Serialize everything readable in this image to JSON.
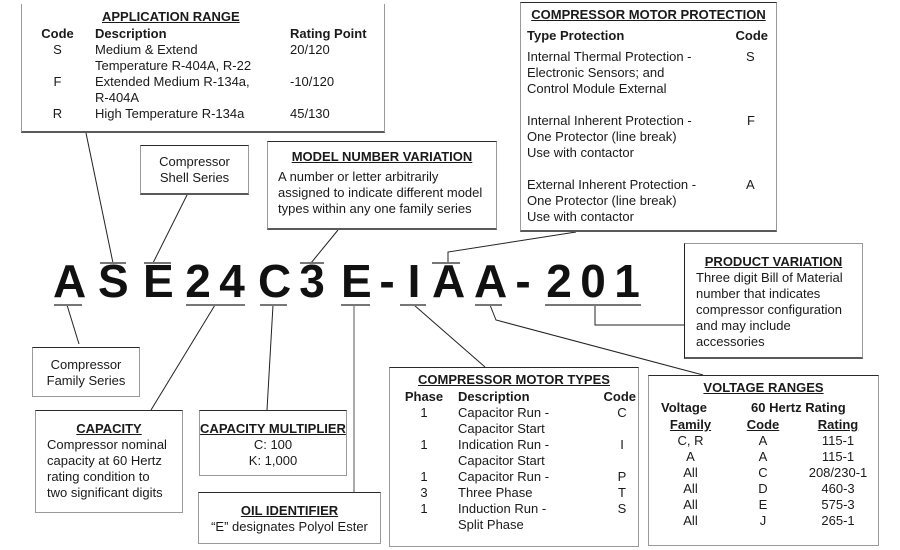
{
  "model_number": {
    "characters": [
      "A",
      "S",
      "E",
      "2",
      "4",
      "C",
      "3",
      "E",
      "-",
      "I",
      "A",
      "A",
      "-",
      "2",
      "0",
      "1"
    ]
  },
  "application_range": {
    "title": "APPLICATION RANGE",
    "headers": [
      "Code",
      "Description",
      "Rating Point"
    ],
    "rows": [
      {
        "code": "S",
        "description_lines": [
          "Medium & Extend",
          "Temperature R-404A, R-22"
        ],
        "rating": "20/120"
      },
      {
        "code": "F",
        "description_lines": [
          "Extended Medium R-134a,",
          "R-404A"
        ],
        "rating": "-10/120"
      },
      {
        "code": "R",
        "description_lines": [
          "High Temperature R-134a"
        ],
        "rating": "45/130"
      }
    ]
  },
  "shell_series": {
    "lines": [
      "Compressor",
      "Shell Series"
    ]
  },
  "model_number_variation": {
    "title": "MODEL NUMBER VARIATION",
    "lines": [
      "A number or letter arbitrarily",
      "assigned to indicate different model",
      "types within any one family series"
    ]
  },
  "motor_protection": {
    "title": "COMPRESSOR MOTOR PROTECTION",
    "headers": [
      "Type Protection",
      "Code"
    ],
    "rows": [
      {
        "lines": [
          "Internal Thermal Protection -",
          "Electronic Sensors; and",
          "Control Module External"
        ],
        "code": "S"
      },
      {
        "lines": [
          "Internal Inherent Protection -",
          "One Protector (line break)",
          "Use with contactor"
        ],
        "code": "F"
      },
      {
        "lines": [
          "External Inherent Protection -",
          "One Protector (line break)",
          "Use with contactor"
        ],
        "code": "A"
      }
    ]
  },
  "product_variation": {
    "title": "PRODUCT VARIATION",
    "lines": [
      "Three digit Bill of Material",
      "number that indicates",
      "compressor configuration",
      "and may include",
      "accessories"
    ]
  },
  "family_series": {
    "lines": [
      "Compressor",
      "Family Series"
    ]
  },
  "capacity": {
    "title": "CAPACITY",
    "lines": [
      "Compressor nominal",
      "capacity at 60 Hertz",
      "rating condition to",
      "two significant digits"
    ]
  },
  "capacity_multiplier": {
    "title": "CAPACITY MULTIPLIER",
    "lines": [
      "C: 100",
      "K: 1,000"
    ]
  },
  "oil_identifier": {
    "title": "OIL IDENTIFIER",
    "text": "“E” designates Polyol Ester"
  },
  "motor_types": {
    "title": "COMPRESSOR MOTOR TYPES",
    "headers": [
      "Phase",
      "Description",
      "Code"
    ],
    "rows": [
      {
        "phase": "1",
        "lines": [
          "Capacitor Run -",
          "Capacitor Start"
        ],
        "code": "C"
      },
      {
        "phase": "1",
        "lines": [
          "Indication Run -",
          "Capacitor Start"
        ],
        "code": "I"
      },
      {
        "phase": "1",
        "lines": [
          "Capacitor Run -"
        ],
        "code": "P"
      },
      {
        "phase": "3",
        "lines": [
          "Three Phase"
        ],
        "code": "T"
      },
      {
        "phase": "1",
        "lines": [
          "Induction Run -",
          "Split Phase"
        ],
        "code": "S"
      }
    ]
  },
  "voltage_ranges": {
    "title": "VOLTAGE RANGES",
    "header_top": [
      "Voltage",
      "60 Hertz Rating"
    ],
    "headers": [
      "Family",
      "Code",
      "Rating"
    ],
    "rows": [
      {
        "family": "C, R",
        "code": "A",
        "rating": "115-1"
      },
      {
        "family": "A",
        "code": "A",
        "rating": "115-1"
      },
      {
        "family": "All",
        "code": "C",
        "rating": "208/230-1"
      },
      {
        "family": "All",
        "code": "D",
        "rating": "460-3"
      },
      {
        "family": "All",
        "code": "E",
        "rating": "575-3"
      },
      {
        "family": "All",
        "code": "J",
        "rating": "265-1"
      }
    ]
  }
}
